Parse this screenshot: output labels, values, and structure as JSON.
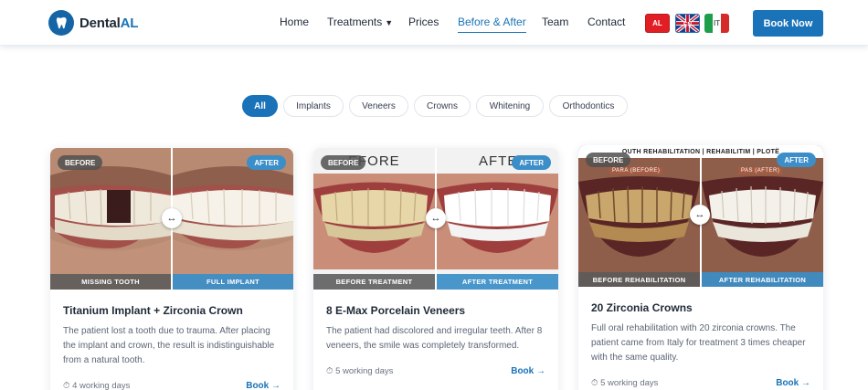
{
  "brand": {
    "name_prefix": "Dental",
    "name_accent": "AL"
  },
  "nav": {
    "home": "Home",
    "treatments": "Treatments",
    "prices": "Prices",
    "before_after": "Before & After",
    "team": "Team",
    "contact": "Contact"
  },
  "languages": {
    "al": "AL",
    "en": "EN",
    "it": "IT"
  },
  "header": {
    "book_now": "Book Now"
  },
  "filters": [
    "All",
    "Implants",
    "Veneers",
    "Crowns",
    "Whitening",
    "Orthodontics"
  ],
  "active_filter": "All",
  "colors": {
    "accent": "#1a73b8",
    "after_badge": "#3b8ec8",
    "before_badge": "#555555"
  },
  "cards": [
    {
      "before_badge": "BEFORE",
      "after_badge": "AFTER",
      "left_caption": "MISSING TOOTH",
      "right_caption": "FULL IMPLANT",
      "title": "Titanium Implant + Zirconia Crown",
      "description": "The patient lost a tooth due to trauma. After placing the implant and crown, the result is indistinguishable from a natural tooth.",
      "days": "4 working days",
      "book": "Book →"
    },
    {
      "before_badge": "BEFORE",
      "after_badge": "AFTER",
      "photo_left_text": "EFORE",
      "photo_right_text": "AFTE",
      "left_caption": "BEFORE TREATMENT",
      "right_caption": "AFTER TREATMENT",
      "title": "8 E-Max Porcelain Veneers",
      "description": "The patient had discolored and irregular teeth. After 8 veneers, the smile was completely transformed.",
      "days": "5 working days",
      "book": "Book →"
    },
    {
      "before_badge": "BEFORE",
      "after_badge": "AFTER",
      "banner": "OUTH REHABILITATION | REHABILITIM | PLOTË",
      "photo_left_label": "PARA (BEFORE)",
      "photo_right_label": "PAS (AFTER)",
      "left_caption": "BEFORE REHABILITATION",
      "right_caption": "AFTER REHABILITATION",
      "title": "20 Zirconia Crowns",
      "description": "Full oral rehabilitation with 20 zirconia crowns. The patient came from Italy for treatment 3 times cheaper with the same quality.",
      "days": "5 working days",
      "book": "Book →"
    }
  ]
}
